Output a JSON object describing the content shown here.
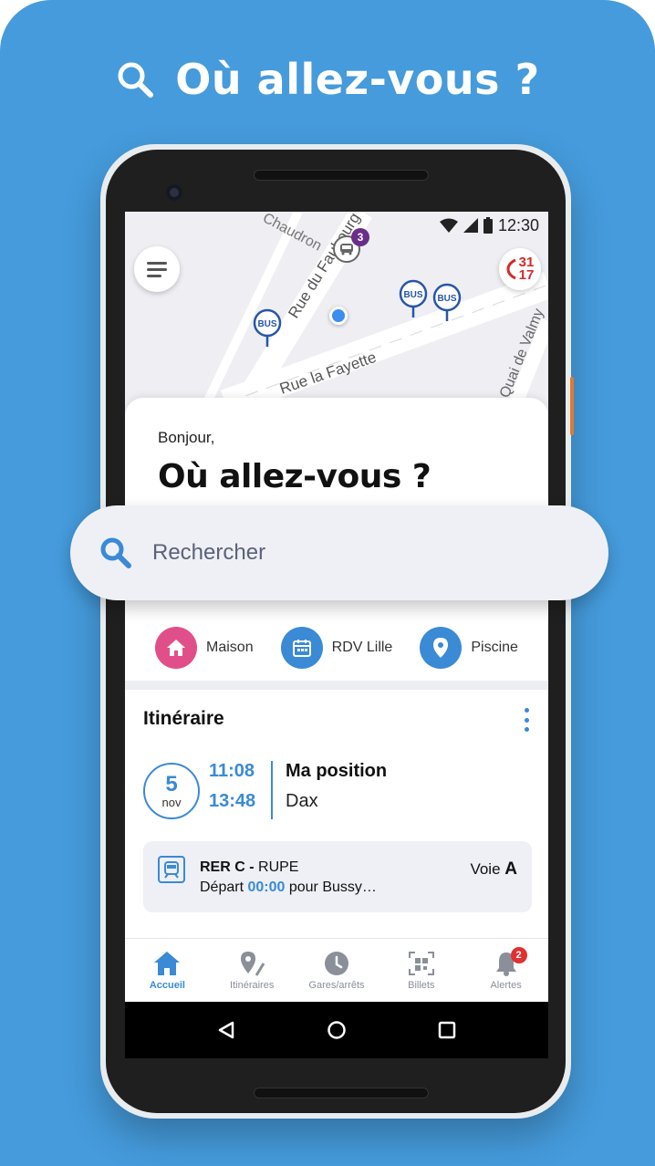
{
  "headline": {
    "text": "Où allez-vous ?"
  },
  "status_bar": {
    "time": "12:30"
  },
  "map": {
    "street_labels": [
      "Chaudron",
      "Rue du Faubourg",
      "Rue la Fayette",
      "Quai de Valmy"
    ],
    "bus_pin_label": "BUS",
    "vehicle_badge_count": "3",
    "sos_label_top": "31",
    "sos_label_bottom": "17"
  },
  "card": {
    "greeting": "Bonjour,",
    "title": "Où allez-vous ?"
  },
  "search": {
    "placeholder": "Rechercher"
  },
  "shortcuts": [
    {
      "label": "Maison",
      "icon": "home-icon",
      "color": "#e14f8a"
    },
    {
      "label": "RDV Lille",
      "icon": "calendar-icon",
      "color": "#3a8ad6"
    },
    {
      "label": "Piscine",
      "icon": "location-pin-icon",
      "color": "#3a8ad6"
    }
  ],
  "itinerary": {
    "title": "Itinéraire",
    "date_day": "5",
    "date_month": "nov",
    "departure_time": "11:08",
    "arrival_time": "13:48",
    "from": "Ma position",
    "to": "Dax",
    "train": {
      "line": "RER C -",
      "code": "RUPE",
      "departure_prefix": "Départ",
      "departure_time": "00:00",
      "departure_suffix": "pour Bussy…",
      "platform_label": "Voie",
      "platform": "A"
    }
  },
  "bottom_nav": [
    {
      "label": "Accueil",
      "icon": "home-icon",
      "active": true
    },
    {
      "label": "Itinéraires",
      "icon": "route-pin-icon",
      "active": false
    },
    {
      "label": "Gares/arrêts",
      "icon": "clock-icon",
      "active": false
    },
    {
      "label": "Billets",
      "icon": "qr-code-icon",
      "active": false
    },
    {
      "label": "Alertes",
      "icon": "bell-icon",
      "active": false,
      "badge": "2"
    }
  ],
  "colors": {
    "background": "#459bdc",
    "accent": "#3a8ad6",
    "pink": "#e14f8a",
    "badge_red": "#e0302f"
  }
}
